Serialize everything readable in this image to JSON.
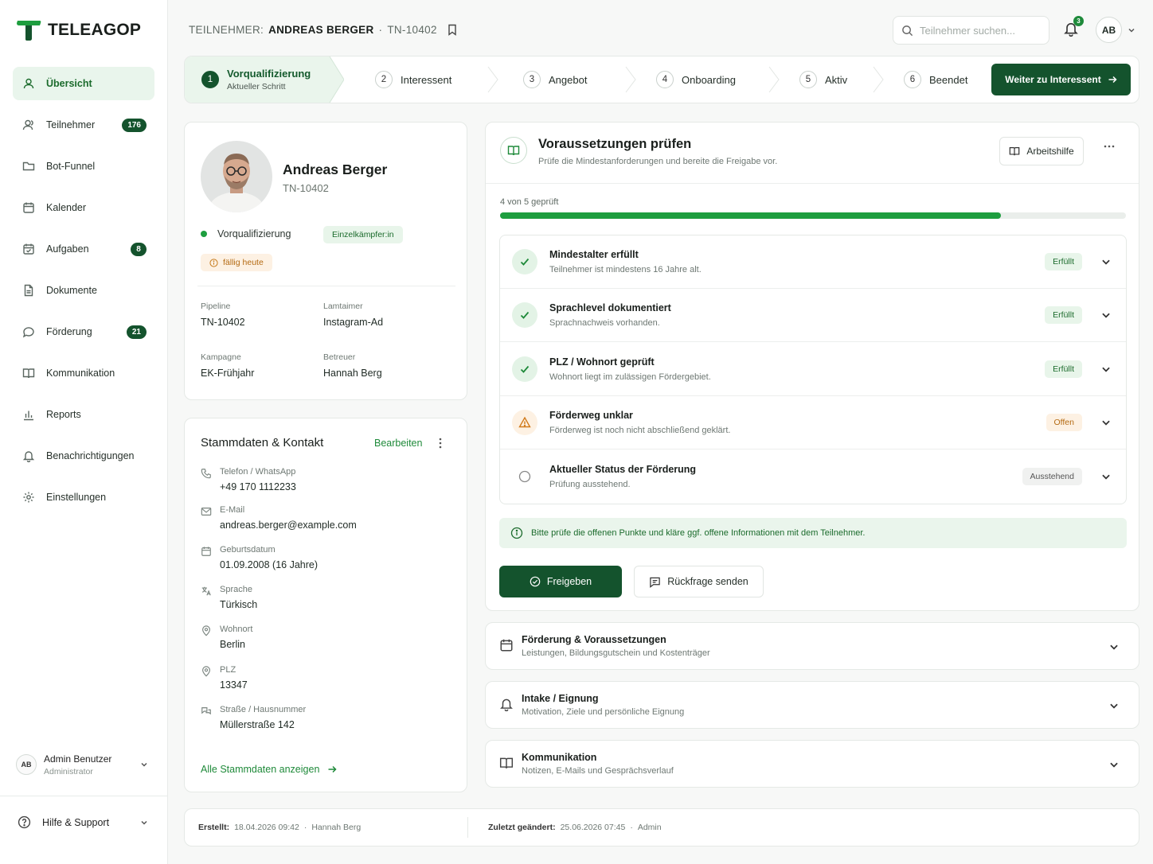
{
  "brand": {
    "name": "TELEAGOP",
    "accent": "#14532d",
    "accent_light": "#1e9e3f"
  },
  "sidebar": {
    "items": [
      {
        "label": "Übersicht",
        "icon": "user-icon",
        "active": true
      },
      {
        "label": "Teilnehmer",
        "icon": "users-icon",
        "badge": "176"
      },
      {
        "label": "Bot-Funnel",
        "icon": "folder-icon"
      },
      {
        "label": "Kalender",
        "icon": "calendar-icon"
      },
      {
        "label": "Aufgaben",
        "icon": "calendar-check-icon",
        "badge": "8"
      },
      {
        "label": "Dokumente",
        "icon": "document-icon"
      },
      {
        "label": "Förderung",
        "icon": "chat-icon",
        "badge": "21"
      },
      {
        "label": "Kommunikation",
        "icon": "book-icon"
      },
      {
        "label": "Reports",
        "icon": "bar-chart-icon"
      },
      {
        "label": "Benachrichtigungen",
        "icon": "bell-icon"
      },
      {
        "label": "Einstellungen",
        "icon": "gear-icon"
      }
    ],
    "user": {
      "initials": "AB",
      "name": "Admin Benutzer",
      "role": "Administrator"
    },
    "help": "Hilfe & Support"
  },
  "header": {
    "crumb_prefix": "TEILNEHMER:",
    "crumb_name": "ANDREAS BERGER",
    "crumb_sep": "·",
    "crumb_id": "TN-10402",
    "search_placeholder": "Teilnehmer suchen...",
    "notifications": "3",
    "avatar": "AB"
  },
  "stepper": {
    "steps": [
      {
        "num": "1",
        "label": "Vorqualifizierung",
        "sub": "Aktueller Schritt"
      },
      {
        "num": "2",
        "label": "Interessent"
      },
      {
        "num": "3",
        "label": "Angebot"
      },
      {
        "num": "4",
        "label": "Onboarding"
      },
      {
        "num": "5",
        "label": "Aktiv"
      },
      {
        "num": "6",
        "label": "Beendet"
      }
    ],
    "next_button": "Weiter zu Interessent"
  },
  "profile": {
    "name": "Andreas Berger",
    "id": "TN-10402",
    "status": "Vorqualifizierung",
    "tag": "Einzelkämpfer:in",
    "due": "fällig heute",
    "meta": [
      {
        "label": "Pipeline",
        "value": "TN-10402"
      },
      {
        "label": "Lamtaimer",
        "value": "Instagram-Ad"
      },
      {
        "label": "Kampagne",
        "value": "EK-Frühjahr"
      },
      {
        "label": "Betreuer",
        "value": "Hannah Berg"
      }
    ]
  },
  "contact": {
    "title": "Stammdaten & Kontakt",
    "edit": "Bearbeiten",
    "rows": [
      {
        "label": "Telefon / WhatsApp",
        "value": "+49 170 1112233",
        "icon": "phone-icon"
      },
      {
        "label": "E-Mail",
        "value": "andreas.berger@example.com",
        "icon": "mail-icon"
      },
      {
        "label": "Geburtsdatum",
        "value": "01.09.2008 (16 Jahre)",
        "icon": "calendar-icon"
      },
      {
        "label": "Sprache",
        "value": "Türkisch",
        "icon": "language-icon"
      },
      {
        "label": "Wohnort",
        "value": "Berlin",
        "icon": "pin-icon"
      },
      {
        "label": "PLZ",
        "value": "13347",
        "icon": "pin-icon"
      },
      {
        "label": "Straße / Hausnummer",
        "value": "Müllerstraße 142",
        "icon": "street-icon"
      }
    ],
    "show_all": "Alle Stammdaten anzeigen"
  },
  "requirements": {
    "title": "Voraussetzungen prüfen",
    "subtitle": "Prüfe die Mindestanforderungen und bereite die Freigabe vor.",
    "help_button": "Arbeitshilfe",
    "progress_label": "4 von 5 geprüft",
    "progress": 0.8,
    "items": [
      {
        "title": "Mindestalter erfüllt",
        "sub": "Teilnehmer ist mindestens 16 Jahre alt.",
        "status": "Erfüllt",
        "kind": "ok"
      },
      {
        "title": "Sprachlevel dokumentiert",
        "sub": "Sprachnachweis vorhanden.",
        "status": "Erfüllt",
        "kind": "ok"
      },
      {
        "title": "PLZ / Wohnort geprüft",
        "sub": "Wohnort liegt im zulässigen Fördergebiet.",
        "status": "Erfüllt",
        "kind": "ok"
      },
      {
        "title": "Förderweg unklar",
        "sub": "Förderweg ist noch nicht abschließend geklärt.",
        "status": "Offen",
        "kind": "warn"
      },
      {
        "title": "Aktueller Status der Förderung",
        "sub": "Prüfung ausstehend.",
        "status": "Ausstehend",
        "kind": "pend"
      }
    ],
    "info": "Bitte prüfe die offenen Punkte und kläre ggf. offene Informationen mit dem Teilnehmer.",
    "approve": "Freigeben",
    "query": "Rückfrage senden"
  },
  "accordions": [
    {
      "title": "Förderung & Voraussetzungen",
      "sub": "Leistungen, Bildungsgutschein und Kostenträger",
      "icon": "calendar-icon"
    },
    {
      "title": "Intake / Eignung",
      "sub": "Motivation, Ziele und persönliche Eignung",
      "icon": "bell-icon"
    },
    {
      "title": "Kommunikation",
      "sub": "Notizen, E-Mails und Gesprächsverlauf",
      "icon": "book-icon"
    }
  ],
  "footer": {
    "created_label": "Erstellt:",
    "created_date": "18.04.2026 09:42",
    "created_by": "Hannah Berg",
    "changed_label": "Zuletzt geändert:",
    "changed_date": "25.06.2026 07:45",
    "changed_by": "Admin",
    "sep": "·"
  }
}
